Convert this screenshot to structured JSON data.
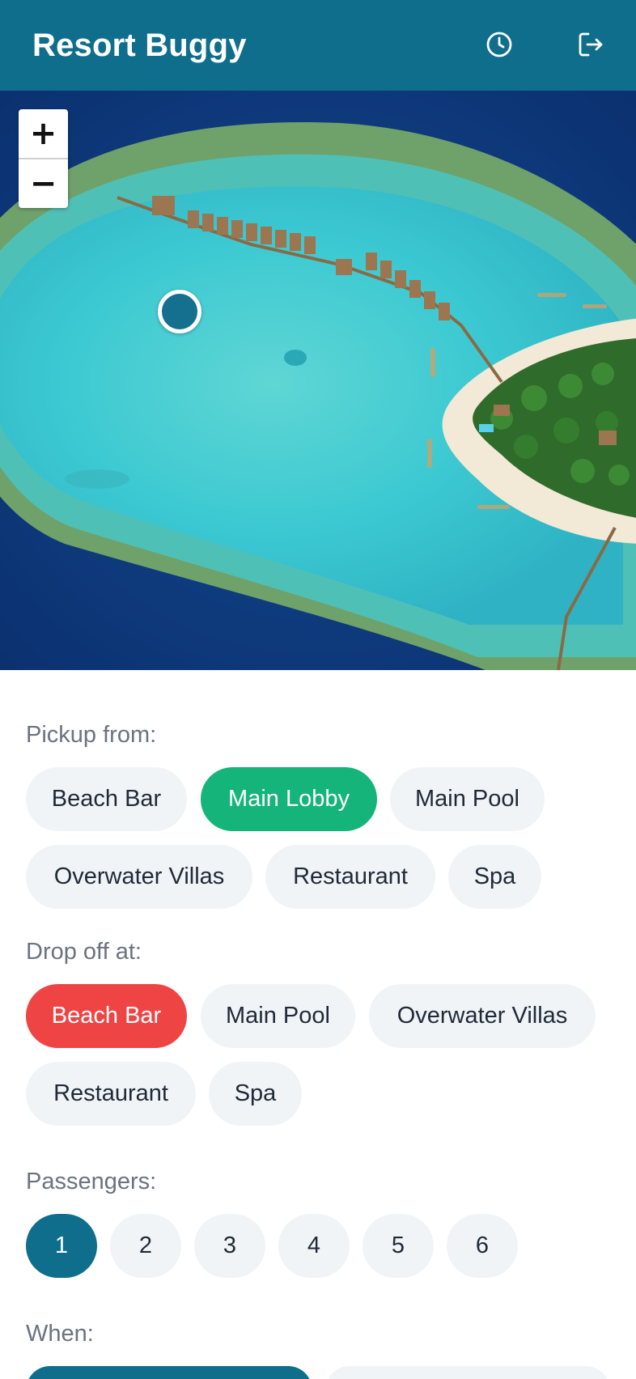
{
  "header": {
    "title": "Resort Buggy",
    "history_icon": "clock-icon",
    "logout_icon": "logout-icon",
    "background": "#0f6e8c"
  },
  "map": {
    "zoom_in_label": "+",
    "zoom_out_label": "−"
  },
  "pickup": {
    "label": "Pickup from:",
    "selected": "Main Lobby",
    "options": [
      "Beach Bar",
      "Main Lobby",
      "Main Pool",
      "Overwater Villas",
      "Restaurant",
      "Spa"
    ],
    "selected_color": "#14b47a"
  },
  "dropoff": {
    "label": "Drop off at:",
    "selected": "Beach Bar",
    "options": [
      "Beach Bar",
      "Main Pool",
      "Overwater Villas",
      "Restaurant",
      "Spa"
    ],
    "selected_color": "#ef4444"
  },
  "passengers": {
    "label": "Passengers:",
    "selected": "1",
    "options": [
      "1",
      "2",
      "3",
      "4",
      "5",
      "6"
    ]
  },
  "when": {
    "label": "When:"
  }
}
